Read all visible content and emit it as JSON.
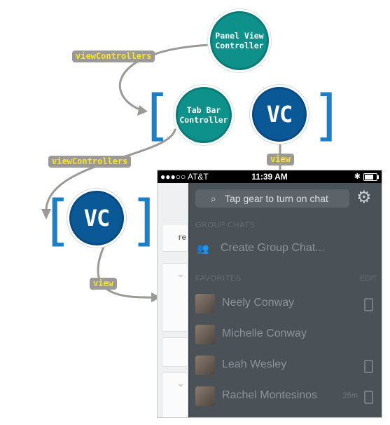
{
  "diagram": {
    "nodes": {
      "panel_view_controller": "Panel View\nController",
      "tab_bar_controller": "Tab Bar\nController",
      "vc_top": "VC",
      "vc_left": "VC"
    },
    "edge_labels": {
      "view_controllers_1": "viewControllers",
      "view_controllers_2": "viewControllers",
      "view_top": "view",
      "view_left": "view"
    },
    "brackets": {
      "open": "[",
      "close": "]"
    }
  },
  "phone": {
    "status_bar": {
      "carrier": "●●●○○ AT&T",
      "time": "11:39 AM",
      "bluetooth": "✱"
    },
    "behind_panel": {
      "partial_button": "re"
    },
    "chat_panel": {
      "search_placeholder": "Tap gear to turn on chat",
      "search_icon": "search-icon",
      "gear_icon": "gear-icon",
      "group_chats_header": "GROUP CHATS",
      "create_group": "Create Group Chat...",
      "favorites_header": "FAVORITES",
      "favorites_edit": "EDIT",
      "favorites": [
        {
          "name": "Neely Conway",
          "device": true,
          "duration": ""
        },
        {
          "name": "Michelle Conway",
          "device": false,
          "duration": ""
        },
        {
          "name": "Leah Wesley",
          "device": true,
          "duration": ""
        },
        {
          "name": "Rachel Montesinos",
          "device": true,
          "duration": "26m"
        }
      ]
    }
  }
}
